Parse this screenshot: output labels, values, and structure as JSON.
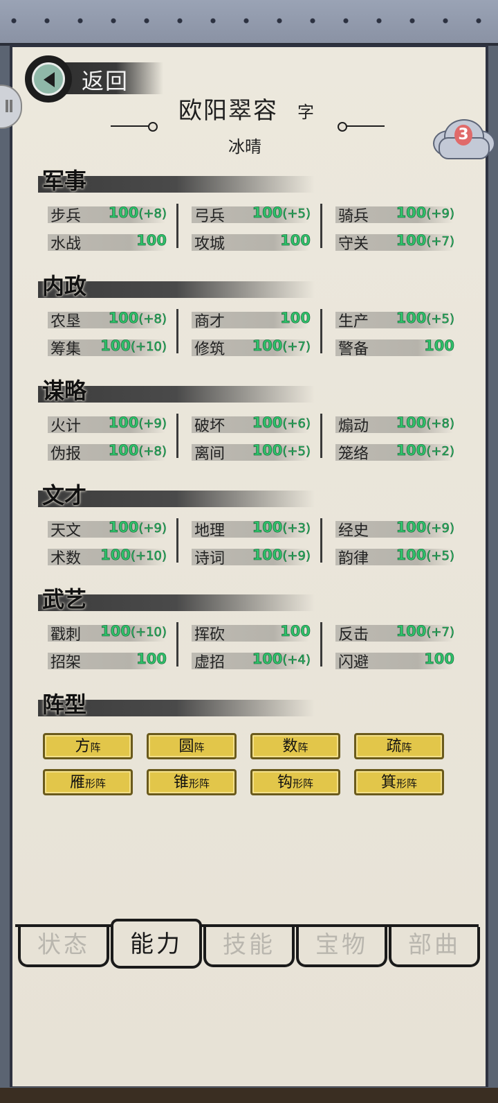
{
  "back": {
    "label": "返回"
  },
  "header": {
    "name": "欧阳翠容",
    "zi_label": "字",
    "courtesy_name": "冰晴"
  },
  "badge": {
    "count": "3"
  },
  "colors": {
    "value_green": "#2fc06a",
    "formation_gold": "#e2c64a"
  },
  "sections": [
    {
      "title": "军事",
      "stats": [
        {
          "label": "步兵",
          "value": "100",
          "bonus": "(+8)"
        },
        {
          "label": "弓兵",
          "value": "100",
          "bonus": "(+5)"
        },
        {
          "label": "骑兵",
          "value": "100",
          "bonus": "(+9)"
        },
        {
          "label": "水战",
          "value": "100",
          "bonus": ""
        },
        {
          "label": "攻城",
          "value": "100",
          "bonus": ""
        },
        {
          "label": "守关",
          "value": "100",
          "bonus": "(+7)"
        }
      ]
    },
    {
      "title": "内政",
      "stats": [
        {
          "label": "农垦",
          "value": "100",
          "bonus": "(+8)"
        },
        {
          "label": "商才",
          "value": "100",
          "bonus": ""
        },
        {
          "label": "生产",
          "value": "100",
          "bonus": "(+5)"
        },
        {
          "label": "筹集",
          "value": "100",
          "bonus": "(+10)"
        },
        {
          "label": "修筑",
          "value": "100",
          "bonus": "(+7)"
        },
        {
          "label": "警备",
          "value": "100",
          "bonus": ""
        }
      ]
    },
    {
      "title": "谋略",
      "stats": [
        {
          "label": "火计",
          "value": "100",
          "bonus": "(+9)"
        },
        {
          "label": "破坏",
          "value": "100",
          "bonus": "(+6)"
        },
        {
          "label": "煽动",
          "value": "100",
          "bonus": "(+8)"
        },
        {
          "label": "伪报",
          "value": "100",
          "bonus": "(+8)"
        },
        {
          "label": "离间",
          "value": "100",
          "bonus": "(+5)"
        },
        {
          "label": "笼络",
          "value": "100",
          "bonus": "(+2)"
        }
      ]
    },
    {
      "title": "文才",
      "stats": [
        {
          "label": "天文",
          "value": "100",
          "bonus": "(+9)"
        },
        {
          "label": "地理",
          "value": "100",
          "bonus": "(+3)"
        },
        {
          "label": "经史",
          "value": "100",
          "bonus": "(+9)"
        },
        {
          "label": "术数",
          "value": "100",
          "bonus": "(+10)"
        },
        {
          "label": "诗词",
          "value": "100",
          "bonus": "(+9)"
        },
        {
          "label": "韵律",
          "value": "100",
          "bonus": "(+5)"
        }
      ]
    },
    {
      "title": "武艺",
      "stats": [
        {
          "label": "戳刺",
          "value": "100",
          "bonus": "(+10)"
        },
        {
          "label": "挥砍",
          "value": "100",
          "bonus": ""
        },
        {
          "label": "反击",
          "value": "100",
          "bonus": "(+7)"
        },
        {
          "label": "招架",
          "value": "100",
          "bonus": ""
        },
        {
          "label": "虚招",
          "value": "100",
          "bonus": "(+4)"
        },
        {
          "label": "闪避",
          "value": "100",
          "bonus": ""
        }
      ]
    }
  ],
  "formation": {
    "title": "阵型",
    "items": [
      {
        "main": "方",
        "suffix": "阵"
      },
      {
        "main": "圆",
        "suffix": "阵"
      },
      {
        "main": "数",
        "suffix": "阵"
      },
      {
        "main": "疏",
        "suffix": "阵"
      },
      {
        "main": "雁",
        "suffix": "形阵"
      },
      {
        "main": "锥",
        "suffix": "形阵"
      },
      {
        "main": "钩",
        "suffix": "形阵"
      },
      {
        "main": "箕",
        "suffix": "形阵"
      }
    ]
  },
  "tabs": [
    {
      "label": "状态",
      "active": false
    },
    {
      "label": "能力",
      "active": true
    },
    {
      "label": "技能",
      "active": false
    },
    {
      "label": "宝物",
      "active": false
    },
    {
      "label": "部曲",
      "active": false
    }
  ]
}
